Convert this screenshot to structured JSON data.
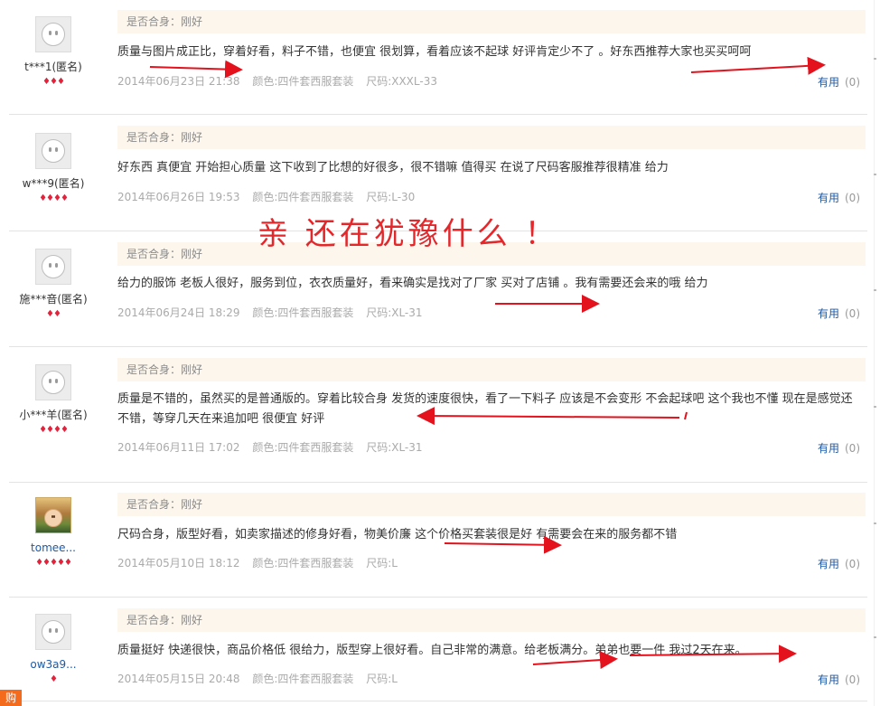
{
  "promo_text": "亲 还在犹豫什么 ！",
  "buy_tab": "购",
  "reviews": [
    {
      "user": "t***1(匿名)",
      "gems": 3,
      "fit": "是否合身：刚好",
      "content": "质量与图片成正比，穿着好看，料子不错，也便宜 很划算，看着应该不起球 好评肯定少不了 。好东西推荐大家也买买呵呵",
      "date": "2014年06月23日 21:38",
      "color": "颜色:四件套西服套装",
      "size": "尺码:XXXL-33",
      "useful_label": "有用",
      "useful_count": "(0)"
    },
    {
      "user": "w***9(匿名)",
      "gems": 4,
      "fit": "是否合身：刚好",
      "content": "好东西 真便宜 开始担心质量 这下收到了比想的好很多，很不错嘛 值得买 在说了尺码客服推荐很精准 给力",
      "date": "2014年06月26日 19:53",
      "color": "颜色:四件套西服套装",
      "size": "尺码:L-30",
      "useful_label": "有用",
      "useful_count": "(0)"
    },
    {
      "user": "施***音(匿名)",
      "gems": 2,
      "fit": "是否合身：刚好",
      "content": "给力的服饰 老板人很好，服务到位，衣衣质量好，看来确实是找对了厂家 买对了店铺 。我有需要还会来的哦 给力",
      "date": "2014年06月24日 18:29",
      "color": "颜色:四件套西服套装",
      "size": "尺码:XL-31",
      "useful_label": "有用",
      "useful_count": "(0)"
    },
    {
      "user": "小***羊(匿名)",
      "gems": 4,
      "fit": "是否合身：刚好",
      "content": "质量是不错的，虽然买的是普通版的。穿着比较合身 发货的速度很快，看了一下料子 应该是不会变形 不会起球吧 这个我也不懂 现在是感觉还不错，等穿几天在来追加吧 很便宜 好评",
      "date": "2014年06月11日 17:02",
      "color": "颜色:四件套西服套装",
      "size": "尺码:XL-31",
      "useful_label": "有用",
      "useful_count": "(0)"
    },
    {
      "user": "tomee...",
      "gems": 5,
      "fit": "是否合身：刚好",
      "content": "尺码合身，版型好看，如卖家描述的修身好看，物美价廉 这个价格买套装很是好 有需要会在来的服务都不错",
      "date": "2014年05月10日 18:12",
      "color": "颜色:四件套西服套装",
      "size": "尺码:L",
      "useful_label": "有用",
      "useful_count": "(0)"
    },
    {
      "user": "ow3a9...",
      "gems": 1,
      "fit": "是否合身：刚好",
      "content": "质量挺好 快递很快，商品价格低 很给力，版型穿上很好看。自己非常的满意。给老板满分。弟弟也要一件 我过2天在来。",
      "date": "2014年05月15日 20:48",
      "color": "颜色:四件套西服套装",
      "size": "尺码:L",
      "useful_label": "有用",
      "useful_count": "(0)"
    }
  ]
}
